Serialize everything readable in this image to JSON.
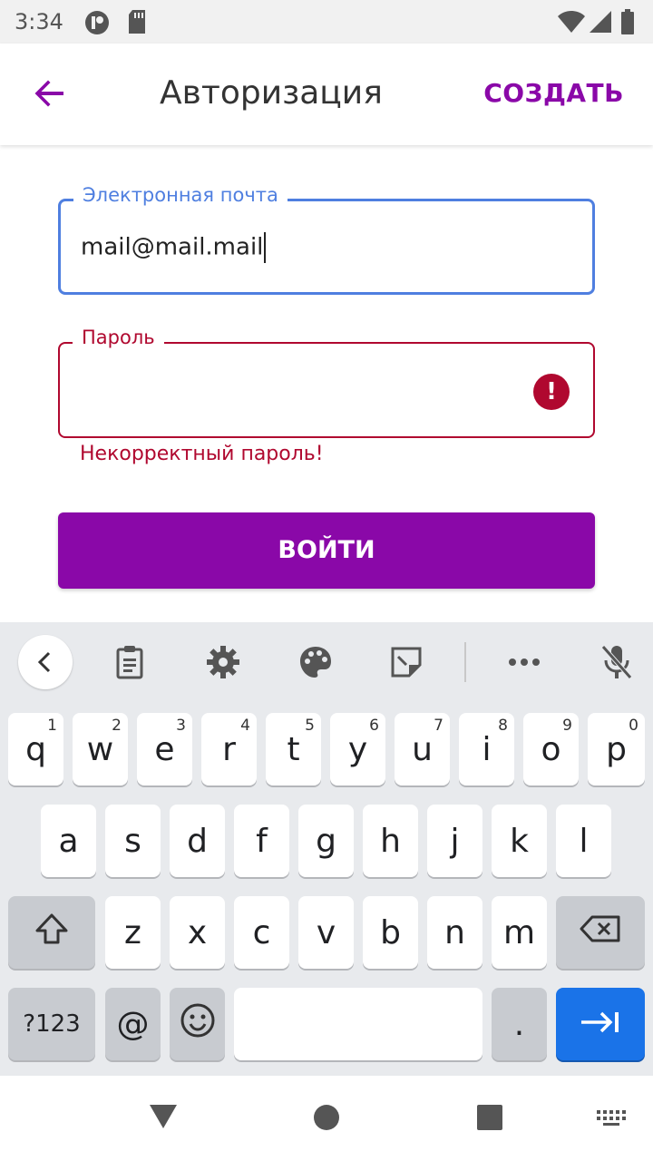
{
  "status_bar": {
    "time": "3:34"
  },
  "app_bar": {
    "title": "Авторизация",
    "action_label": "СОЗДАТЬ"
  },
  "form": {
    "email": {
      "label": "Электронная почта",
      "value": "mail@mail.mail"
    },
    "password": {
      "label": "Пароль",
      "value": "",
      "error_icon": "!",
      "error_text": "Некорректный пароль!"
    },
    "submit_label": "ВОЙТИ"
  },
  "keyboard": {
    "toolbar_icons": [
      "chevron-left-icon",
      "clipboard-icon",
      "gear-icon",
      "palette-icon",
      "sticker-icon",
      "more-icon",
      "mic-off-icon"
    ],
    "row1": [
      {
        "key": "q",
        "hint": "1"
      },
      {
        "key": "w",
        "hint": "2"
      },
      {
        "key": "e",
        "hint": "3"
      },
      {
        "key": "r",
        "hint": "4"
      },
      {
        "key": "t",
        "hint": "5"
      },
      {
        "key": "y",
        "hint": "6"
      },
      {
        "key": "u",
        "hint": "7"
      },
      {
        "key": "i",
        "hint": "8"
      },
      {
        "key": "o",
        "hint": "9"
      },
      {
        "key": "p",
        "hint": "0"
      }
    ],
    "row2": [
      "a",
      "s",
      "d",
      "f",
      "g",
      "h",
      "j",
      "k",
      "l"
    ],
    "row3": [
      "z",
      "x",
      "c",
      "v",
      "b",
      "n",
      "m"
    ],
    "symbols_label": "?123",
    "at_label": "@",
    "period_label": ".",
    "accent_color": "#1a73e8"
  },
  "colors": {
    "primary": "#8a08a8",
    "focus": "#4f7fe0",
    "error": "#b0082f"
  }
}
